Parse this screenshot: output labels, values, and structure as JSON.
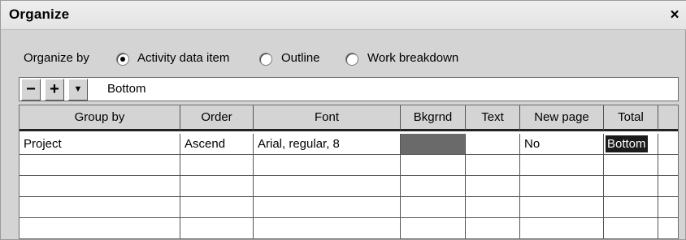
{
  "dialog": {
    "title": "Organize",
    "close_label": "×"
  },
  "organize_by": {
    "label": "Organize by",
    "options": [
      {
        "label": "Activity data item",
        "selected": true
      },
      {
        "label": "Outline",
        "selected": false
      },
      {
        "label": "Work breakdown",
        "selected": false
      }
    ]
  },
  "toolbar": {
    "minus": "−",
    "plus": "+",
    "dropdown": "▼",
    "value": "Bottom"
  },
  "grid": {
    "columns": [
      "Group by",
      "Order",
      "Font",
      "Bkgrnd",
      "Text",
      "New page",
      "Total",
      ""
    ],
    "rows": [
      [
        "Project",
        "Ascend",
        "Arial, regular, 8",
        "",
        "",
        "No",
        "Bottom",
        ""
      ],
      [
        "",
        "",
        "",
        "",
        "",
        "",
        "",
        ""
      ],
      [
        "",
        "",
        "",
        "",
        "",
        "",
        "",
        ""
      ],
      [
        "",
        "",
        "",
        "",
        "",
        "",
        "",
        ""
      ],
      [
        "",
        "",
        "",
        "",
        "",
        "",
        "",
        ""
      ]
    ]
  },
  "colors": {
    "bkgrnd_swatch": "#6a6a6a",
    "selected_cell": "#1b1b1b"
  }
}
